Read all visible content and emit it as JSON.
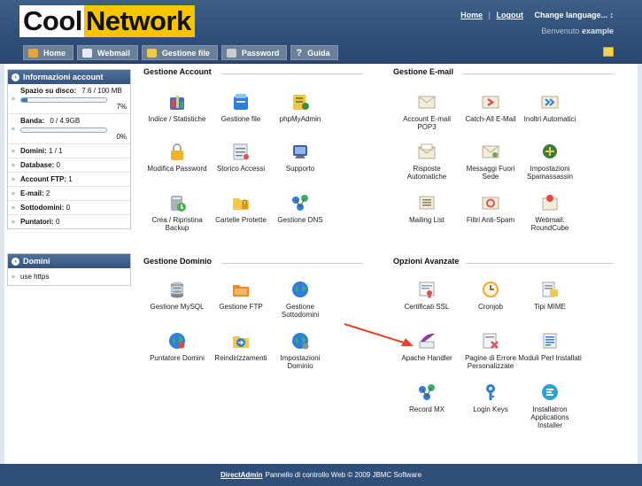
{
  "header": {
    "logo_part1": "Cool",
    "logo_part2": "Network",
    "links": {
      "home": "Home",
      "logout": "Logout",
      "separator": "|",
      "language": "Change language... ↕"
    },
    "welcome_prefix": "Benvenuto",
    "welcome_user": "example"
  },
  "tabs": [
    {
      "label": "Home",
      "icon": "home-icon"
    },
    {
      "label": "Webmail",
      "icon": "mail-icon"
    },
    {
      "label": "Gestione file",
      "icon": "folder-icon"
    },
    {
      "label": "Password",
      "icon": "key-icon"
    },
    {
      "label": "Guida",
      "icon": "question-icon"
    }
  ],
  "sidebar": {
    "account": {
      "title": "Informazioni account",
      "disk_label": "Spazio su disco:",
      "disk_value": "7.6 / 100 MB",
      "disk_pct": "7%",
      "disk_fraction": 0.07,
      "band_label": "Banda:",
      "band_value": "0 / 4.9GB",
      "band_pct": "0%",
      "band_fraction": 0,
      "rows": [
        {
          "label": "Domini:",
          "value": "1 / 1"
        },
        {
          "label": "Database:",
          "value": "0"
        },
        {
          "label": "Account FTP:",
          "value": "1"
        },
        {
          "label": "E-mail:",
          "value": "2"
        },
        {
          "label": "Sottodomini:",
          "value": "0"
        },
        {
          "label": "Puntatori:",
          "value": "0"
        }
      ]
    },
    "domains": {
      "title": "Domini",
      "items": [
        "use https"
      ]
    }
  },
  "sections": {
    "account": {
      "title": "Gestione Account",
      "items": [
        "Indice / Statistiche",
        "Gestione file",
        "phpMyAdmin",
        "Modifica Password",
        "Storico Accessi",
        "Supporto",
        "Crea / Ripristina Backup",
        "Cartelle Protette",
        "Gestione DNS"
      ]
    },
    "email": {
      "title": "Gestione E-mail",
      "items": [
        "Account E-mail POP3",
        "Catch-All E-Mail",
        "Inoltri Automatici",
        "Risposte Automatiche",
        "Messaggi Fuori Sede",
        "Impostazioni Spamassassin",
        "Mailing List",
        "Filtri Anti-Spam",
        "Webmail: RoundCube"
      ]
    },
    "domain": {
      "title": "Gestione Dominio",
      "items": [
        "Gestione MySQL",
        "Gestione FTP",
        "Gestione Sottodomini",
        "Puntatore Domini",
        "Reindirizzamenti",
        "Impostazioni Dominio"
      ]
    },
    "advanced": {
      "title": "Opzioni Avanzate",
      "items": [
        "Certificati SSL",
        "Cronjob",
        "Tipi MIME",
        "Apache Handler",
        "Pagine di Errore Personalizzate",
        "Moduli Perl Installati",
        "Record MX",
        "Login Keys",
        "Installatron Applications Installer"
      ]
    }
  },
  "footer": {
    "link": "DirectAdmin",
    "text": "Pannello di controllo Web © 2009 JBMC Software"
  },
  "colors": {
    "header": "#2f4f78",
    "tab": "#6a7f99",
    "logo_yellow": "#f6c500",
    "progress": "#3b79c2",
    "annotation_arrow": "#e8402f"
  }
}
